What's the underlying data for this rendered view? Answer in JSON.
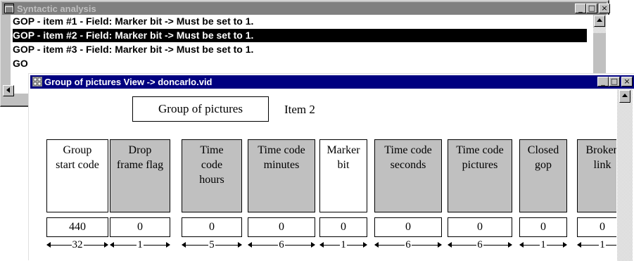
{
  "back_window": {
    "title": "Syntactic analysis",
    "rows": [
      "GOP - item #1 - Field: Marker bit -> Must be set to 1.",
      "GOP - item #2 - Field: Marker bit -> Must be set to 1.",
      "GOP - item #3 - Field: Marker bit -> Must be set to 1.",
      "GO"
    ],
    "selected_row": 1
  },
  "front_window": {
    "title": "Group of pictures View -> doncarlo.vid",
    "header_box": "Group of pictures",
    "item_label": "Item  2",
    "fields": [
      {
        "label": "Group\nstart code",
        "value": "440",
        "bits": "32",
        "shaded": false
      },
      {
        "label": "Drop\nframe flag",
        "value": "0",
        "bits": "1",
        "shaded": true
      },
      {
        "label": "Time\ncode\nhours",
        "value": "0",
        "bits": "5",
        "shaded": true
      },
      {
        "label": "Time code\nminutes",
        "value": "0",
        "bits": "6",
        "shaded": true
      },
      {
        "label": "Marker\nbit",
        "value": "0",
        "bits": "1",
        "shaded": false
      },
      {
        "label": "Time code\nseconds",
        "value": "0",
        "bits": "6",
        "shaded": true
      },
      {
        "label": "Time code\npictures",
        "value": "0",
        "bits": "6",
        "shaded": true
      },
      {
        "label": "Closed\ngop",
        "value": "0",
        "bits": "1",
        "shaded": true
      },
      {
        "label": "Broken\nlink",
        "value": "0",
        "bits": "1",
        "shaded": true
      }
    ]
  },
  "controls": {
    "minimize": "_",
    "maximize": "□",
    "close": "×"
  },
  "icons": [
    "list-window-icon",
    "grid-window-icon",
    "scroll-up-arrow-icon",
    "scroll-left-arrow-icon"
  ],
  "colors": {
    "active_title": "#000080",
    "inactive_title": "#808080",
    "face": "#c0c0c0",
    "selection": "#000000"
  }
}
